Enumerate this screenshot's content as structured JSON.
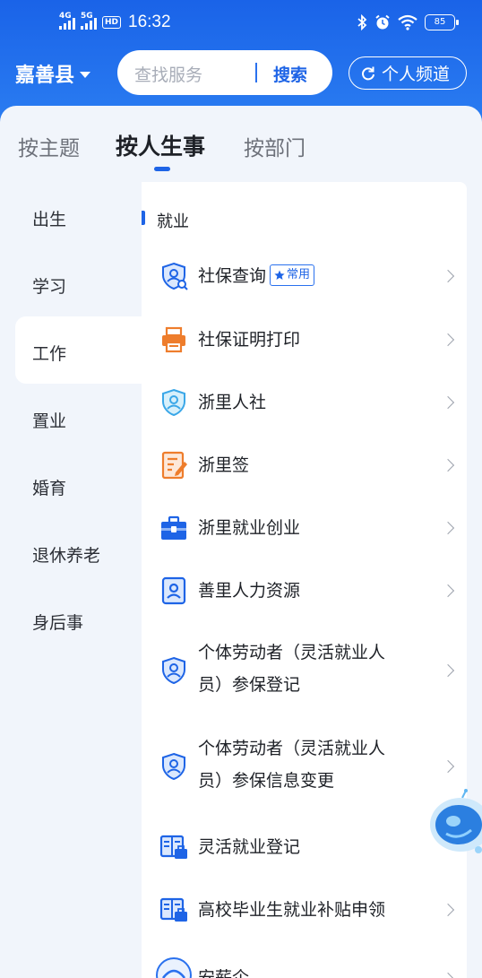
{
  "status_bar": {
    "net1": "4G",
    "net2": "5G",
    "hd": "HD",
    "time": "16:32",
    "battery": "85"
  },
  "header": {
    "county": "嘉善县",
    "search_placeholder": "查找服务",
    "search_button": "搜索",
    "channel_button": "个人频道"
  },
  "tabs": [
    {
      "label": "按主题",
      "active": false
    },
    {
      "label": "按人生事",
      "active": true
    },
    {
      "label": "按部门",
      "active": false
    }
  ],
  "sidebar": {
    "items": [
      "出生",
      "学习",
      "工作",
      "置业",
      "婚育",
      "退休养老",
      "身后事"
    ],
    "active": "工作"
  },
  "section": {
    "title": "就业",
    "items": [
      {
        "label": "社保查询",
        "badge": "常用",
        "icon": "shield-search-icon"
      },
      {
        "label": "社保证明打印",
        "icon": "printer-icon"
      },
      {
        "label": "浙里人社",
        "icon": "shield-user-icon"
      },
      {
        "label": "浙里签",
        "icon": "document-sign-icon"
      },
      {
        "label": "浙里就业创业",
        "icon": "briefcase-icon"
      },
      {
        "label": "善里人力资源",
        "icon": "id-card-icon"
      },
      {
        "label": "个体劳动者（灵活就业人",
        "label2": "员）参保登记",
        "icon": "shield-user-icon"
      },
      {
        "label": "个体劳动者（灵活就业人",
        "label2": "员）参保信息变更",
        "icon": "shield-user-icon"
      },
      {
        "label": "灵活就业登记",
        "icon": "book-briefcase-icon"
      },
      {
        "label": "高校毕业生就业补贴申领",
        "icon": "book-briefcase-icon"
      },
      {
        "label": "安薪企",
        "icon": "circle-logo-icon"
      }
    ]
  },
  "colors": {
    "primary": "#1e64e6",
    "orange": "#ee7d2c",
    "teal": "#3aa7e8"
  }
}
